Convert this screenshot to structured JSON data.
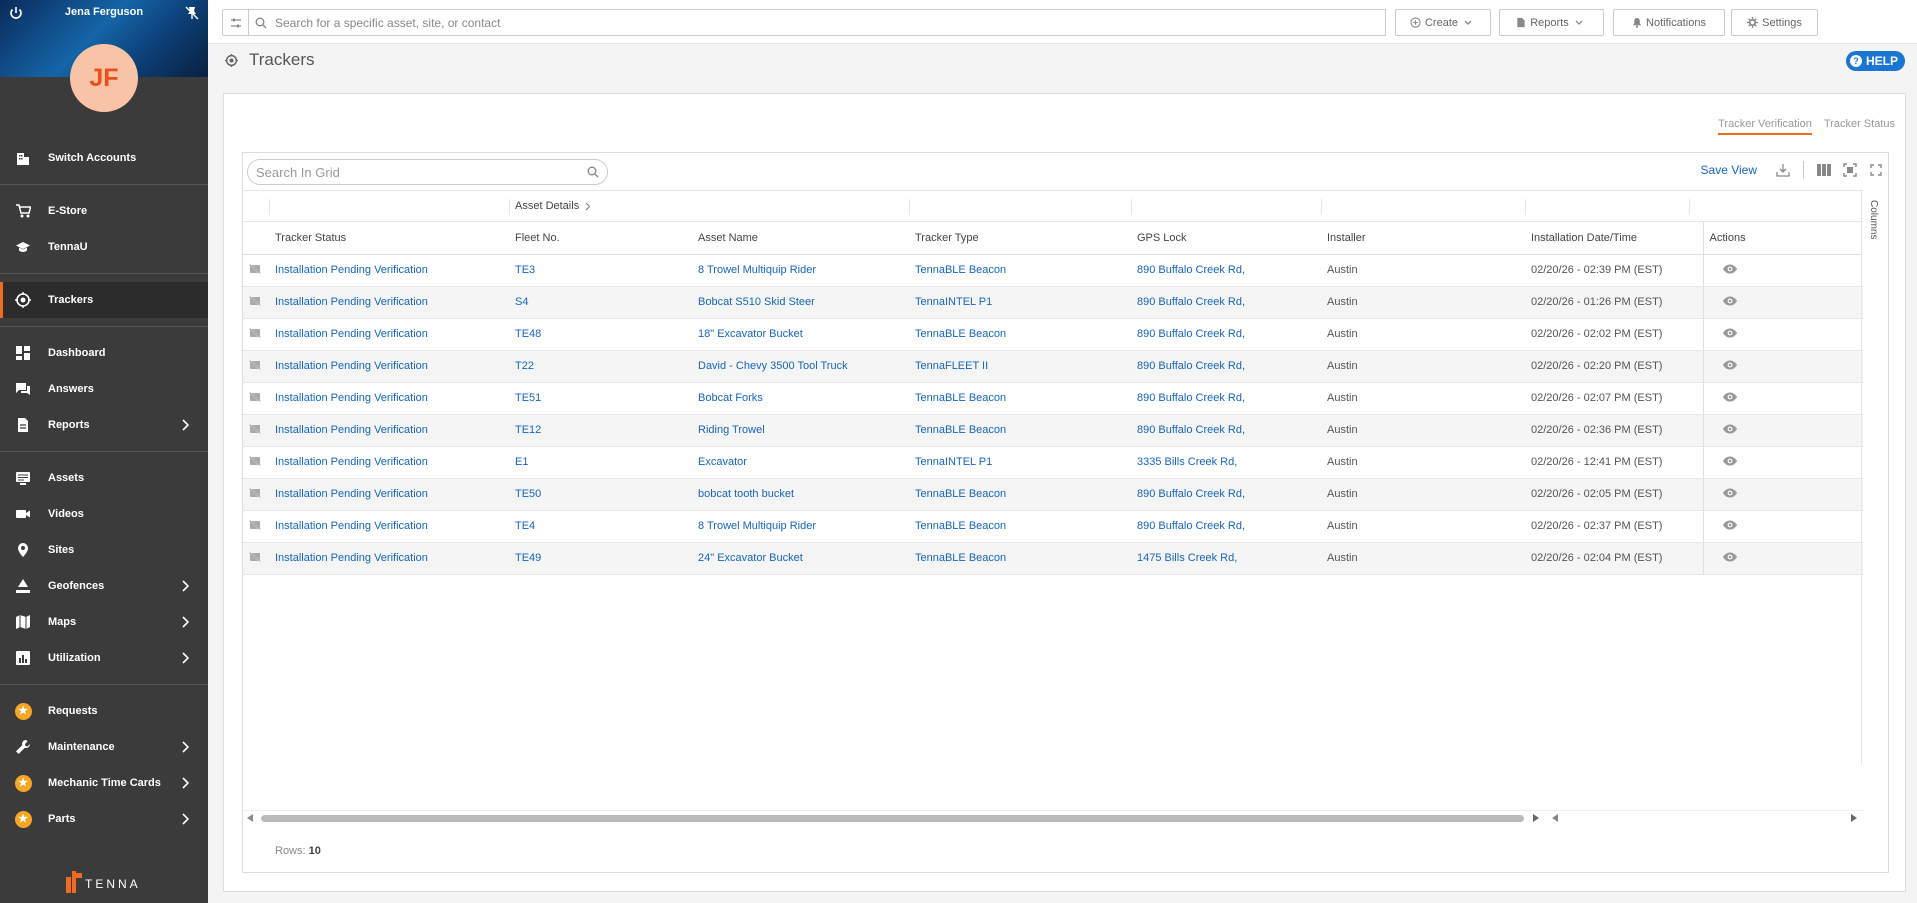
{
  "user": {
    "name": "Jena Ferguson",
    "initials": "JF"
  },
  "sidebar": {
    "items": [
      {
        "label": "Switch Accounts",
        "icon": "building-icon"
      },
      {
        "label": "E-Store",
        "icon": "cart-icon"
      },
      {
        "label": "TennaU",
        "icon": "graduation-cap-icon"
      },
      {
        "label": "Trackers",
        "icon": "tracker-chip-icon"
      },
      {
        "label": "Dashboard",
        "icon": "dashboard-icon"
      },
      {
        "label": "Answers",
        "icon": "chat-icon"
      },
      {
        "label": "Reports",
        "icon": "report-icon"
      },
      {
        "label": "Assets",
        "icon": "list-icon"
      },
      {
        "label": "Videos",
        "icon": "video-icon"
      },
      {
        "label": "Sites",
        "icon": "location-pin-icon"
      },
      {
        "label": "Geofences",
        "icon": "geofence-icon"
      },
      {
        "label": "Maps",
        "icon": "map-icon"
      },
      {
        "label": "Utilization",
        "icon": "bar-chart-icon"
      },
      {
        "label": "Requests",
        "icon": "star-badge-icon"
      },
      {
        "label": "Maintenance",
        "icon": "wrench-icon"
      },
      {
        "label": "Mechanic Time Cards",
        "icon": "star-badge-icon"
      },
      {
        "label": "Parts",
        "icon": "star-badge-icon"
      }
    ],
    "active": "Trackers",
    "logo": "TENNA",
    "brand_color": "#f26a21"
  },
  "topbar": {
    "search_placeholder": "Search for a specific asset, site, or contact",
    "create_label": "Create",
    "reports_label": "Reports",
    "notifications_label": "Notifications",
    "settings_label": "Settings"
  },
  "page": {
    "title": "Trackers",
    "help_label": "HELP"
  },
  "tabs": [
    {
      "label": "Tracker Verification",
      "active": true
    },
    {
      "label": "Tracker Status",
      "active": false
    }
  ],
  "grid": {
    "search_placeholder": "Search In Grid",
    "save_view_label": "Save View",
    "group_label": "Asset Details",
    "columns_label": "Columns",
    "headers": [
      "Tracker Status",
      "Fleet No.",
      "Asset Name",
      "Tracker Type",
      "GPS Lock",
      "Installer",
      "Installation Date/Time",
      "Actions"
    ],
    "rows": [
      {
        "status": "Installation Pending Verification",
        "fleet": "TE3",
        "asset": "8 Trowel Multiquip Rider",
        "type": "TennaBLE Beacon",
        "gps": "890 Buffalo Creek Rd,",
        "installer": "Austin",
        "date": "02/20/26 - 02:39 PM (EST)"
      },
      {
        "status": "Installation Pending Verification",
        "fleet": "S4",
        "asset": "Bobcat S510 Skid Steer",
        "type": "TennaINTEL P1",
        "gps": "890 Buffalo Creek Rd,",
        "installer": "Austin",
        "date": "02/20/26 - 01:26 PM (EST)"
      },
      {
        "status": "Installation Pending Verification",
        "fleet": "TE48",
        "asset": "18\" Excavator Bucket",
        "type": "TennaBLE Beacon",
        "gps": "890 Buffalo Creek Rd,",
        "installer": "Austin",
        "date": "02/20/26 - 02:02 PM (EST)"
      },
      {
        "status": "Installation Pending Verification",
        "fleet": "T22",
        "asset": "David - Chevy 3500 Tool Truck",
        "type": "TennaFLEET II",
        "gps": "890 Buffalo Creek Rd,",
        "installer": "Austin",
        "date": "02/20/26 - 02:20 PM (EST)"
      },
      {
        "status": "Installation Pending Verification",
        "fleet": "TE51",
        "asset": "Bobcat Forks",
        "type": "TennaBLE Beacon",
        "gps": "890 Buffalo Creek Rd,",
        "installer": "Austin",
        "date": "02/20/26 - 02:07 PM (EST)"
      },
      {
        "status": "Installation Pending Verification",
        "fleet": "TE12",
        "asset": "Riding Trowel",
        "type": "TennaBLE Beacon",
        "gps": "890 Buffalo Creek Rd,",
        "installer": "Austin",
        "date": "02/20/26 - 02:36 PM (EST)"
      },
      {
        "status": "Installation Pending Verification",
        "fleet": "E1",
        "asset": "Excavator",
        "type": "TennaINTEL P1",
        "gps": "3335 Bills Creek Rd,",
        "installer": "Austin",
        "date": "02/20/26 - 12:41 PM (EST)"
      },
      {
        "status": "Installation Pending Verification",
        "fleet": "TE50",
        "asset": "bobcat tooth bucket",
        "type": "TennaBLE Beacon",
        "gps": "890 Buffalo Creek Rd,",
        "installer": "Austin",
        "date": "02/20/26 - 02:05 PM (EST)"
      },
      {
        "status": "Installation Pending Verification",
        "fleet": "TE4",
        "asset": "8 Trowel Multiquip Rider",
        "type": "TennaBLE Beacon",
        "gps": "890 Buffalo Creek Rd,",
        "installer": "Austin",
        "date": "02/20/26 - 02:37 PM (EST)"
      },
      {
        "status": "Installation Pending Verification",
        "fleet": "TE49",
        "asset": "24\" Excavator Bucket",
        "type": "TennaBLE Beacon",
        "gps": "1475 Bills Creek Rd,",
        "installer": "Austin",
        "date": "02/20/26 - 02:04 PM (EST)"
      }
    ],
    "rows_label": "Rows:",
    "rows_count": "10"
  },
  "colors": {
    "link": "#1565c0",
    "accent": "#f26a21",
    "help": "#1976d2"
  }
}
